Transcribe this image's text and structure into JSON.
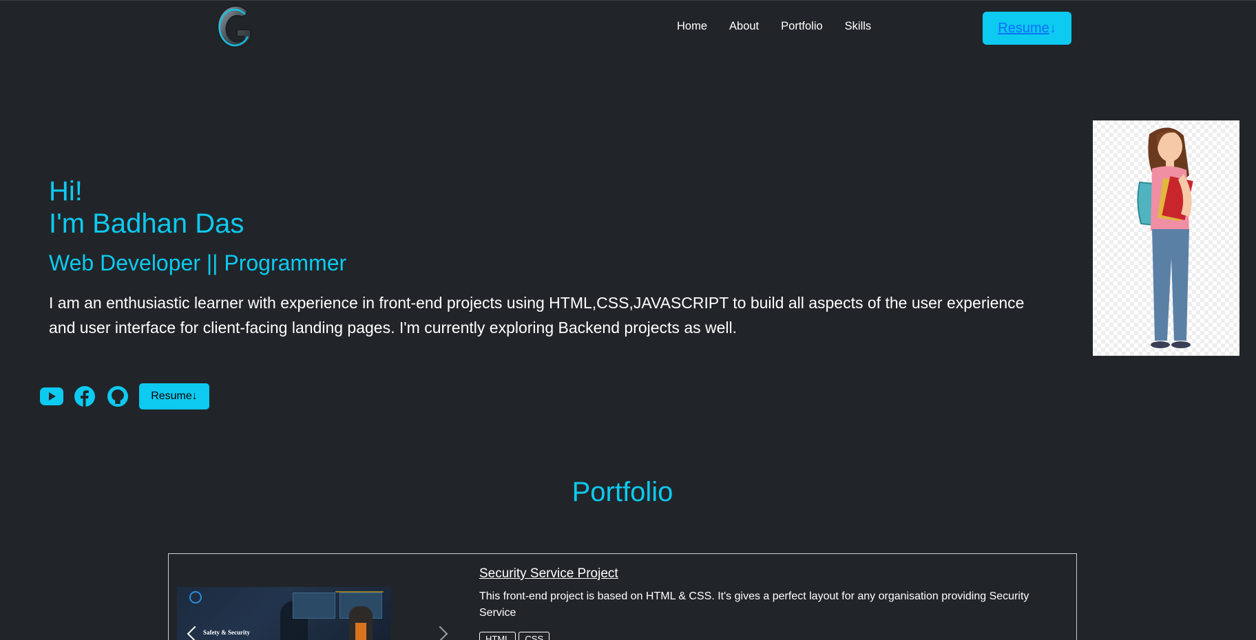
{
  "nav": {
    "logo_letter": "G",
    "links": [
      "Home",
      "About",
      "Portfolio",
      "Skills"
    ],
    "resume_label": "Resume",
    "resume_arrow": "↓"
  },
  "hero": {
    "greeting": "Hi!",
    "name_line": "I'm Badhan Das",
    "role": "Web Developer || Programmer",
    "description": "I am an enthusiastic learner with experience in front-end projects using HTML,CSS,JAVASCRIPT to build all aspects of the user experience and user interface for client-facing landing pages. I'm currently exploring Backend projects as well.",
    "resume_label": "Resume",
    "resume_arrow": "↓",
    "socials": [
      "youtube-icon",
      "facebook-icon",
      "github-icon"
    ]
  },
  "portfolio": {
    "title": "Portfolio",
    "projects": [
      {
        "title": "Security Service Project",
        "description": "This front-end project is based on HTML & CSS. It's gives a perfect layout for any organisation providing Security Service",
        "image_caption": "Safety & Security",
        "tags": [
          "HTML",
          "CSS"
        ]
      }
    ]
  },
  "colors": {
    "background": "#212529",
    "accent": "#0dcaf0",
    "link": "#0d6efd",
    "text": "#ffffff"
  }
}
